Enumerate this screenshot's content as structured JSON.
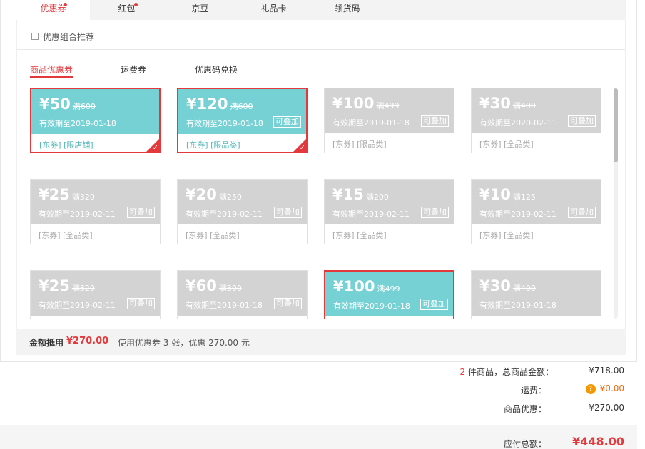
{
  "tabs": [
    {
      "label": "优惠券",
      "dot": true,
      "active": true
    },
    {
      "label": "红包",
      "dot": true,
      "active": false
    },
    {
      "label": "京豆",
      "dot": false,
      "active": false
    },
    {
      "label": "礼品卡",
      "dot": false,
      "active": false
    },
    {
      "label": "领货码",
      "dot": false,
      "active": false
    }
  ],
  "combo_label": "优惠组合推荐",
  "subtabs": [
    "商品优惠券",
    "运费券",
    "优惠码兑换"
  ],
  "coupons": [
    {
      "amount": "¥50",
      "cond": "满600",
      "expire": "有效期至2019-01-18",
      "stack": "",
      "tags": "[东券] [限店铺]",
      "on": true,
      "selected": true
    },
    {
      "amount": "¥120",
      "cond": "满600",
      "expire": "有效期至2019-01-18",
      "stack": "可叠加",
      "tags": "[东券] [限品类]",
      "on": true,
      "selected": true
    },
    {
      "amount": "¥100",
      "cond": "满499",
      "expire": "有效期至2019-01-18",
      "stack": "可叠加",
      "tags": "[东券] [限品类]",
      "on": false,
      "selected": false
    },
    {
      "amount": "¥30",
      "cond": "满400",
      "expire": "有效期至2020-02-11",
      "stack": "可叠加",
      "tags": "[东券] [全品类]",
      "on": false,
      "selected": false
    },
    {
      "amount": "¥25",
      "cond": "满320",
      "expire": "有效期至2019-02-11",
      "stack": "可叠加",
      "tags": "[东券] [全品类]",
      "on": false,
      "selected": false
    },
    {
      "amount": "¥20",
      "cond": "满250",
      "expire": "有效期至2019-02-11",
      "stack": "可叠加",
      "tags": "[东券] [全品类]",
      "on": false,
      "selected": false
    },
    {
      "amount": "¥15",
      "cond": "满200",
      "expire": "有效期至2019-02-11",
      "stack": "可叠加",
      "tags": "[东券] [全品类]",
      "on": false,
      "selected": false
    },
    {
      "amount": "¥10",
      "cond": "满125",
      "expire": "有效期至2019-02-11",
      "stack": "可叠加",
      "tags": "[东券] [全品类]",
      "on": false,
      "selected": false
    },
    {
      "amount": "¥25",
      "cond": "满320",
      "expire": "有效期至2019-02-11",
      "stack": "可叠加",
      "tags": "",
      "on": false,
      "selected": false
    },
    {
      "amount": "¥60",
      "cond": "满300",
      "expire": "有效期至2019-01-18",
      "stack": "可叠加",
      "tags": "",
      "on": false,
      "selected": false
    },
    {
      "amount": "¥100",
      "cond": "满499",
      "expire": "有效期至2019-01-18",
      "stack": "可叠加",
      "tags": "",
      "on": true,
      "selected": true
    },
    {
      "amount": "¥30",
      "cond": "满400",
      "expire": "有效期至2019-01-18",
      "stack": "",
      "tags": "",
      "on": false,
      "selected": false
    }
  ],
  "summary": {
    "label": "金额抵用",
    "amount": "¥270.00",
    "desc": "使用优惠券 3 张，优惠 270.00 元"
  },
  "totals": {
    "count": "2",
    "goods_label": " 件商品，总商品金额：",
    "goods_value": "¥718.00",
    "shipping_label": "运费：",
    "shipping_icon": "?",
    "shipping_value": "¥0.00",
    "discount_label": "商品优惠：",
    "discount_value": "-¥270.00",
    "payable_label": "应付总额：",
    "payable_value": "¥448.00"
  }
}
